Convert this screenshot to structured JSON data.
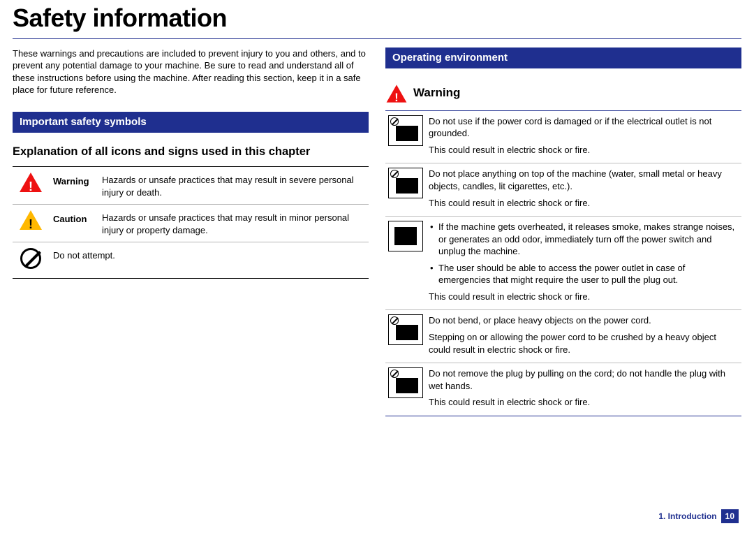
{
  "title": "Safety information",
  "intro": "These warnings and precautions are included to prevent injury to you and others, and to prevent any potential damage to your machine. Be sure to read and understand all of these instructions before using the machine. After reading this section, keep it in a safe place for future reference.",
  "left": {
    "section": "Important safety symbols",
    "subhead": "Explanation of all icons and signs used in this chapter",
    "rows": [
      {
        "label": "Warning",
        "desc": "Hazards or unsafe practices that may result in severe personal injury or death."
      },
      {
        "label": "Caution",
        "desc": "Hazards or unsafe practices that may result in minor personal injury or property damage."
      },
      {
        "label": "",
        "desc": "Do not attempt."
      }
    ]
  },
  "right": {
    "section": "Operating environment",
    "warn_label": "Warning",
    "items": [
      {
        "text": "Do not use if the power cord is damaged or if the electrical outlet is not grounded.",
        "result": "This could result in electric shock or fire."
      },
      {
        "text": "Do not place anything on top of the machine (water, small metal or heavy objects, candles, lit cigarettes, etc.).",
        "result": "This could result in electric shock or fire."
      },
      {
        "bullets": [
          "If the machine gets overheated, it releases smoke, makes strange noises, or generates an odd odor, immediately turn off the power switch and unplug the machine.",
          "The user should be able to access the power outlet in case of emergencies that might require the user to pull the plug out."
        ],
        "result": "This could result in electric shock or fire."
      },
      {
        "text": "Do not bend, or place heavy objects on the power cord.",
        "result": "Stepping on or allowing the power cord to be crushed by a heavy object could result in electric shock or fire."
      },
      {
        "text": "Do not remove the plug by pulling on the cord; do not handle the plug with wet hands.",
        "result": "This could result in electric shock or fire."
      }
    ]
  },
  "footer": {
    "chapter": "1. Introduction",
    "page": "10"
  }
}
